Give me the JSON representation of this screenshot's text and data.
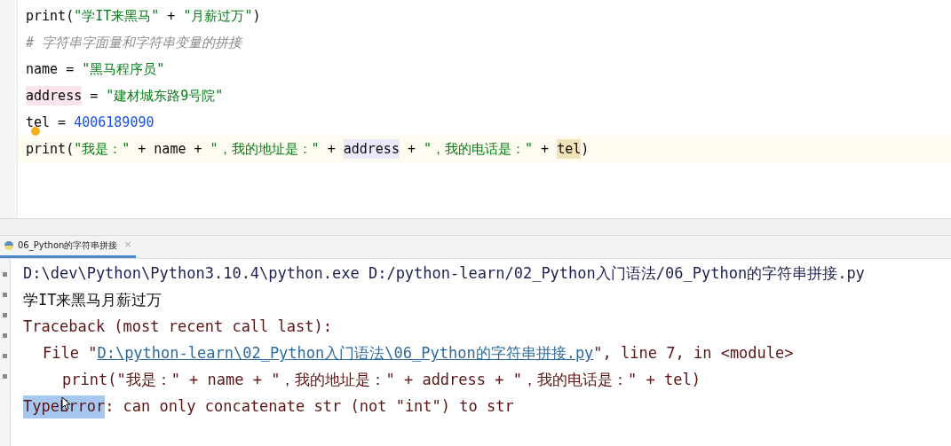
{
  "editor": {
    "lines": [
      {
        "current": false,
        "tokens": [
          {
            "text": "print(",
            "kind": "plain"
          },
          {
            "text": "\"学IT来黑马\"",
            "kind": "string"
          },
          {
            "text": " + ",
            "kind": "plain"
          },
          {
            "text": "\"月薪过万\"",
            "kind": "string"
          },
          {
            "text": ")",
            "kind": "plain"
          }
        ]
      },
      {
        "current": false,
        "tokens": [
          {
            "text": "# 字符串字面量和字符串变量的拼接",
            "kind": "comment"
          }
        ]
      },
      {
        "current": false,
        "tokens": [
          {
            "text": "name = ",
            "kind": "plain"
          },
          {
            "text": "\"黑马程序员\"",
            "kind": "string"
          }
        ]
      },
      {
        "current": false,
        "tokens": [
          {
            "text": "address",
            "kind": "write"
          },
          {
            "text": " = ",
            "kind": "plain"
          },
          {
            "text": "\"建材城东路9号院\"",
            "kind": "string"
          }
        ]
      },
      {
        "current": false,
        "hint": true,
        "tokens": [
          {
            "text": "tel = ",
            "kind": "plain"
          },
          {
            "text": "4006189090",
            "kind": "number"
          }
        ]
      },
      {
        "current": true,
        "tokens": [
          {
            "text": "print(",
            "kind": "plain"
          },
          {
            "text": "\"我是：\"",
            "kind": "string"
          },
          {
            "text": " + name + ",
            "kind": "plain"
          },
          {
            "text": "\"，我的地址是：\"",
            "kind": "string"
          },
          {
            "text": " + ",
            "kind": "plain"
          },
          {
            "text": "address",
            "kind": "read"
          },
          {
            "text": " + ",
            "kind": "plain"
          },
          {
            "text": "\"，我的电话是：\"",
            "kind": "string"
          },
          {
            "text": " + ",
            "kind": "plain"
          },
          {
            "text": "tel",
            "kind": "caret"
          },
          {
            "text": ")",
            "kind": "plain"
          }
        ]
      }
    ]
  },
  "run_tabs": [
    {
      "label": "06_Python的字符串拼接",
      "close": "×",
      "selected": true
    }
  ],
  "console": {
    "lines": [
      {
        "tokens": [
          {
            "text": "D:\\dev\\Python\\Python3.10.4\\python.exe D:/python-learn/02_Python入门语法/06_Python的字符串拼接.py",
            "kind": "command"
          }
        ]
      },
      {
        "tokens": [
          {
            "text": "学IT来黑马月薪过万",
            "kind": "output"
          }
        ]
      },
      {
        "tokens": [
          {
            "text": "Traceback (most recent call last):",
            "kind": "error"
          }
        ],
        "children": [
          {
            "tokens": [
              {
                "text": "File \"",
                "kind": "error"
              },
              {
                "text": "D:\\python-learn\\02_Python入门语法\\06_Python的字符串拼接.py",
                "kind": "link"
              },
              {
                "text": "\", line 7, in <module>",
                "kind": "error"
              }
            ],
            "children": [
              {
                "tokens": [
                  {
                    "text": "print(\"我是：\" + name + \"，我的地址是：\" + address + \"，我的电话是：\" + tel)",
                    "kind": "error"
                  }
                ]
              }
            ]
          }
        ]
      },
      {
        "tokens": [
          {
            "text": "TypeError",
            "kind": "selected"
          },
          {
            "text": ": can only concatenate str (not \"int\") to str",
            "kind": "error"
          }
        ]
      }
    ]
  }
}
